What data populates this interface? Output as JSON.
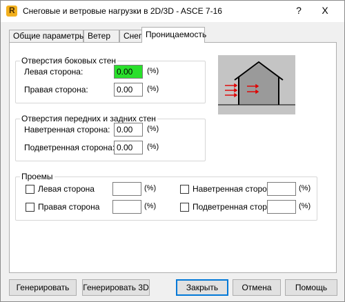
{
  "window": {
    "title": "Снеговые и ветровые нагрузки в 2D/3D - ASCE 7-16",
    "icon_letter": "R",
    "help_label": "?",
    "close_label": "X"
  },
  "tabs": [
    {
      "label": "Общие параметры"
    },
    {
      "label": "Ветер"
    },
    {
      "label": "Снег"
    },
    {
      "label": "Проницаемость",
      "active": true
    }
  ],
  "side_walls": {
    "title": "Отверстия боковых стен",
    "left": {
      "label": "Левая сторона:",
      "value": "0.00",
      "unit": "(%)"
    },
    "right": {
      "label": "Правая сторона:",
      "value": "0.00",
      "unit": "(%)"
    }
  },
  "front_back_walls": {
    "title": "Отверстия передних и задних стен",
    "windward": {
      "label": "Наветренная сторона:",
      "value": "0.00",
      "unit": "(%)"
    },
    "leeward": {
      "label": "Подветренная сторона:",
      "value": "0.00",
      "unit": "(%)"
    }
  },
  "openings": {
    "title": "Проемы",
    "items": [
      {
        "label": "Левая сторона",
        "checked": false,
        "value": "",
        "unit": "(%)"
      },
      {
        "label": "Правая сторона",
        "checked": false,
        "value": "",
        "unit": "(%)"
      },
      {
        "label": "Наветренная сторона",
        "checked": false,
        "value": "",
        "unit": "(%)"
      },
      {
        "label": "Подветренная сторона",
        "checked": false,
        "value": "",
        "unit": "(%)"
      }
    ]
  },
  "buttons": {
    "generate": "Генерировать",
    "generate_3d": "Генерировать 3D",
    "close": "Закрыть",
    "cancel": "Отмена",
    "help": "Помощь"
  },
  "colors": {
    "highlight_field": "#29e02b",
    "wind_arrows": "#e00000",
    "default_button_border": "#0078d7",
    "app_icon": "#f2b01e"
  },
  "icons": [
    "app-logo-icon",
    "help-icon",
    "close-icon",
    "building-diagram-icon"
  ]
}
